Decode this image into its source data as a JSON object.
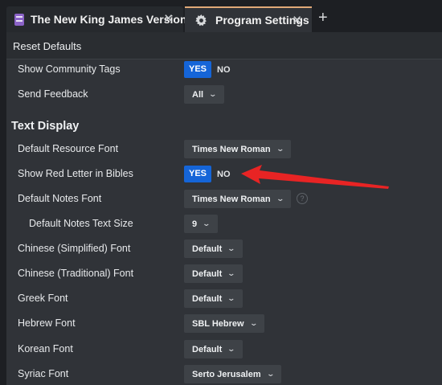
{
  "tabs": [
    {
      "label": "The New King James Version",
      "icon": "bible-book-icon"
    },
    {
      "label": "Program Settings",
      "icon": "gear-icon"
    }
  ],
  "tab_close_glyph": "✕",
  "add_tab_glyph": "+",
  "header": {
    "reset_label": "Reset Defaults"
  },
  "general": {
    "show_community_tags": {
      "label": "Show Community Tags",
      "yes": "YES",
      "no": "NO",
      "selected": "YES"
    },
    "send_feedback": {
      "label": "Send Feedback",
      "value": "All"
    }
  },
  "text_display": {
    "title": "Text Display",
    "default_resource_font": {
      "label": "Default Resource Font",
      "value": "Times New Roman"
    },
    "show_red_letter": {
      "label": "Show Red Letter in Bibles",
      "yes": "YES",
      "no": "NO",
      "selected": "YES"
    },
    "default_notes_font": {
      "label": "Default Notes Font",
      "value": "Times New Roman",
      "help": "?"
    },
    "default_notes_text_size": {
      "label": "Default Notes Text Size",
      "value": "9"
    },
    "chinese_simplified_font": {
      "label": "Chinese (Simplified) Font",
      "value": "Default"
    },
    "chinese_traditional_font": {
      "label": "Chinese (Traditional) Font",
      "value": "Default"
    },
    "greek_font": {
      "label": "Greek Font",
      "value": "Default"
    },
    "hebrew_font": {
      "label": "Hebrew Font",
      "value": "SBL Hebrew"
    },
    "korean_font": {
      "label": "Korean Font",
      "value": "Default"
    },
    "syriac_font": {
      "label": "Syriac Font",
      "value": "Serto Jerusalem"
    }
  },
  "colors": {
    "accent": "#1565d8",
    "annotation_arrow": "#e82424",
    "active_tab_border": "#e0a978"
  }
}
